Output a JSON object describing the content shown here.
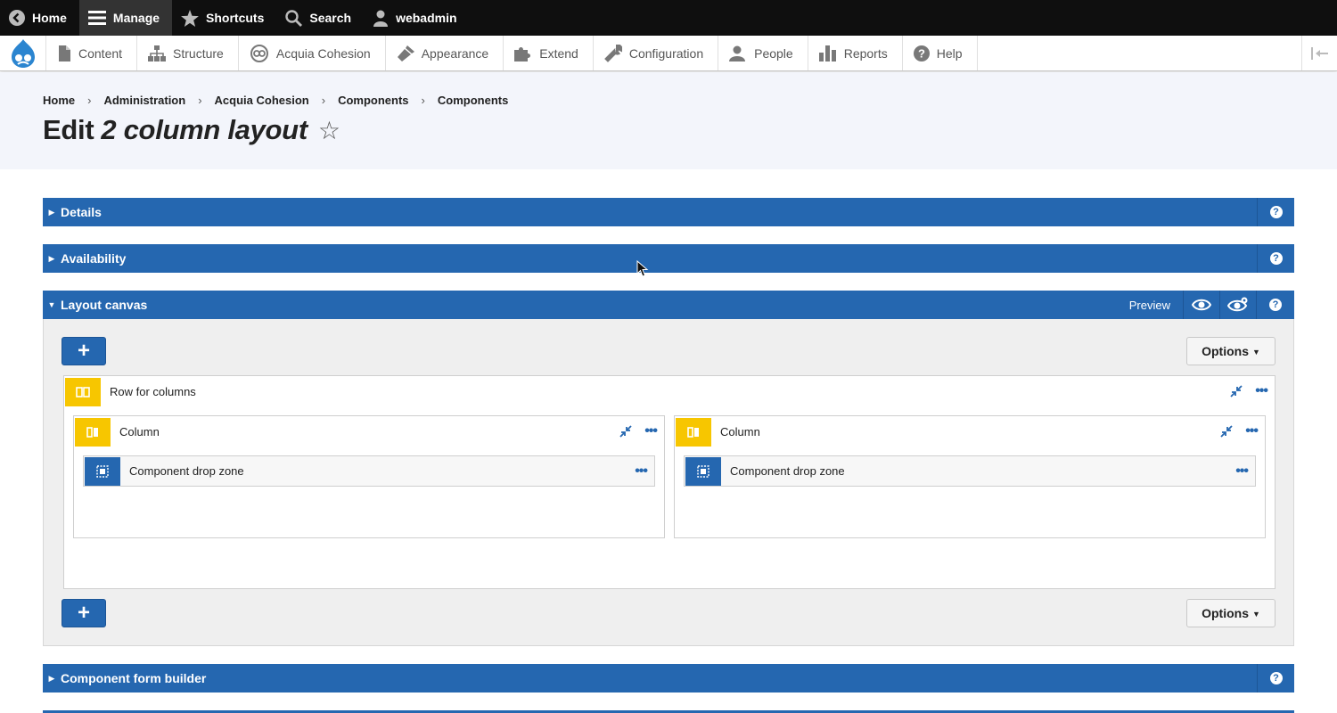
{
  "toolbar": {
    "home": "Home",
    "manage": "Manage",
    "shortcuts": "Shortcuts",
    "search": "Search",
    "user": "webadmin"
  },
  "tray": {
    "items": [
      "Content",
      "Structure",
      "Acquia Cohesion",
      "Appearance",
      "Extend",
      "Configuration",
      "People",
      "Reports",
      "Help"
    ]
  },
  "breadcrumb": [
    "Home",
    "Administration",
    "Acquia Cohesion",
    "Components",
    "Components"
  ],
  "page": {
    "title_prefix": "Edit",
    "title_name": "2 column layout",
    "star": "☆"
  },
  "sections": {
    "details": "Details",
    "availability": "Availability",
    "layout_canvas": "Layout canvas",
    "form_builder": "Component form builder",
    "preview_label": "Preview",
    "help_glyph": "?"
  },
  "canvas": {
    "add_glyph": "+",
    "options_label": "Options",
    "row_label": "Row for columns",
    "columns": [
      {
        "label": "Column",
        "dropzone": "Component drop zone"
      },
      {
        "label": "Column",
        "dropzone": "Component drop zone"
      }
    ]
  },
  "colors": {
    "toolbar_bg": "#0f0f0f",
    "accent_blue": "#2567b0",
    "element_yellow": "#f7c600",
    "header_bg": "#f3f5fb"
  },
  "icons": {
    "toolbar": [
      "back-circle-icon",
      "hamburger-icon",
      "star-icon",
      "search-icon",
      "user-icon"
    ],
    "tray": [
      "drupal-logo-icon",
      "document-icon",
      "structure-icon",
      "cohesion-icon",
      "brush-icon",
      "puzzle-icon",
      "wrench-icon",
      "people-icon",
      "bar-chart-icon",
      "help-icon",
      "collapse-tray-icon"
    ],
    "canvas": [
      "eye-icon",
      "eye-settings-icon",
      "columns-icon",
      "dropzone-icon",
      "collapse-arrows-icon",
      "more-dots-icon"
    ]
  }
}
